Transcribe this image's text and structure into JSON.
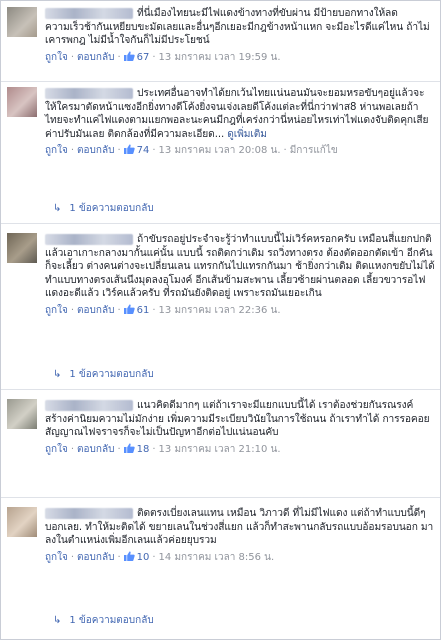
{
  "comments": [
    {
      "text": "ที่นี่เมืองไทยนะมีไฟแดงข้างทางที่ขับผ่าน มีป้ายบอกทางให้ลดความเร็วช้ากันเหยียบขะมัดเลยและอื่นๆอีกเยอะมีกฎข้างหน้าแหก จะมีอะไรดีแค่ไหน ถ้าไม่เคารพกฎ ไม่มีน้ำใจกันก็ไม่มีประโยชน์",
      "like_label": "ถูกใจ",
      "reply_label": "ตอบกลับ",
      "likes": "67",
      "time": "13 มกราคม เวลา 19:59 น."
    },
    {
      "text": "ประเทศอื่นอาจทำได้ยกเว้นไทยแน่นอนมันจะยอมหรอขับๆอยู่แล้วจะให้ใครมาตัดหน้าแซงอีกยิ่งทางดีโค้งยิ่งจนเจ่งเลยดีโค้งแต่ละที่นี่กว่าฟาส8 ห่านพอเลยถ้าไทยจะทำแค่ไฟแดงตามแยกพอละนะคนมีกฎที่เคร่งกว่านี่หน่อยไหรเท่าไฟแดงจับติดคุกเสียค่าปรับมันเลย ติดกล้องที่มีความละเอียด... ",
      "see_more": "ดูเพิ่มเติม",
      "like_label": "ถูกใจ",
      "reply_label": "ตอบกลับ",
      "likes": "74",
      "time": "13 มกราคม เวลา 20:08 น.",
      "edited": "มีการแก้ไข",
      "replies": "1 ข้อความตอบกลับ"
    },
    {
      "text": "ถ้าขับรถอยู่ประจำจะรู้ว่าทำแบบนี้ไม่เวิร์คหรอกครับ เหมือนสี่แยกปกติแล้วเอาเกาะกลางมากั้นแค่นั้น แบบนี้ รถติดกว่าเดิม รถวิ่งทางตรง ต้องตัดออกตัดเข้า อีกคันก็จะเลี้ยว ต่างคนต่างจะเปลี่ยนเลน แทรกกันไปแทรกกันมา ช้ายิ่งกว่าเดิม ติดแหงกขยับไม่ได้ ทำแบบทางตรงเส้นนึงมุดลงอุโมงค์ อีกเส้นข้ามสะพาน เลี้ยวซ้ายผ่านตลอด เลี้ยวขวารอไฟแดงอะดีแล้ว เวิร์คแล้วครับ ที่รถมันยังติดอยู่ เพราะรถมันเยอะเกิน",
      "like_label": "ถูกใจ",
      "reply_label": "ตอบกลับ",
      "likes": "61",
      "time": "13 มกราคม เวลา 22:36 น.",
      "replies": "1 ข้อความตอบกลับ"
    },
    {
      "text": "แนวคิดดีมากๆ แต่ถ้าเราจะมีแยกแบบนี้ได้ เราต้องช่วยกันรณรงค์สร้างค่านิยมความไม่มักง่าย เพิ่มความมีระเบียบวินัยในการใช้ถนน ถ้าเราทำได้ การรอคอยสัญญาณไฟจราจรก็จะไม่เป็นปัญหาอีกต่อไปแน่นอนคับ",
      "like_label": "ถูกใจ",
      "reply_label": "ตอบกลับ",
      "likes": "18",
      "time": "13 มกราคม เวลา 21:10 น."
    },
    {
      "text": "ติดตรงเบี่ยงเลนแทน เหมือน วิภาวดี ที่ไม่มีไฟแดง แต่ถ้าทำแบบนี้ดีๆ บอกเลย. ทำให้มะติดได้ ขยายเลนในช่วงสี่แยก แล้วก็ทำสะพานกลับรถแบบอ้อมรอบนอก มาลงในตำแหน่งเพิ่มอีกเลนแล้วค่อยยุบรวม",
      "like_label": "ถูกใจ",
      "reply_label": "ตอบกลับ",
      "likes": "10",
      "time": "14 มกราคม เวลา 8:56 น.",
      "replies": "1 ข้อความตอบกลับ"
    }
  ],
  "colors": {
    "link": "#4267b2",
    "meta": "#90949c",
    "text": "#1d2129",
    "like_blue": "#5890ff"
  },
  "icons": {
    "like": "thumbs-up-icon",
    "reply_arrow": "reply-arrow-icon"
  }
}
